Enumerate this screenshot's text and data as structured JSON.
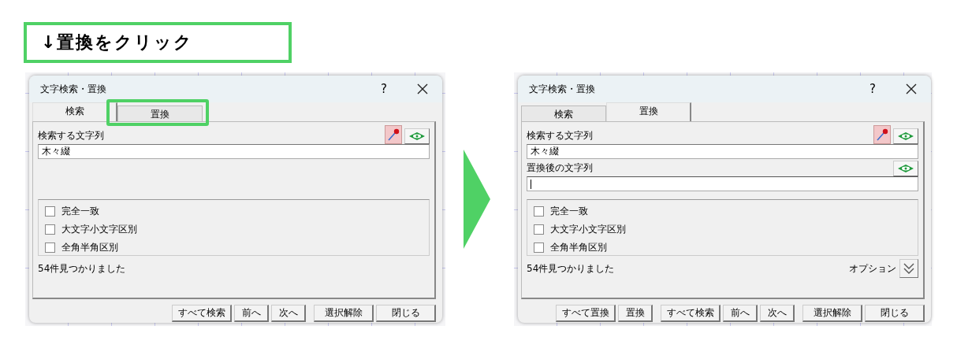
{
  "caption": "↓置換をクリック",
  "dialogs": [
    {
      "title": "文字検索・置換",
      "help": "?",
      "tabs": [
        {
          "label": "検索",
          "selected": true,
          "highlighted": false
        },
        {
          "label": "置換",
          "selected": false,
          "highlighted": true
        }
      ],
      "fields": [
        {
          "kind": "search",
          "label": "検索する文字列",
          "value": "木々綴",
          "focused": false
        }
      ],
      "checkboxes": [
        {
          "label": "完全一致",
          "checked": false
        },
        {
          "label": "大文字小文字区別",
          "checked": false
        },
        {
          "label": "全角半角区別",
          "checked": false
        }
      ],
      "status": "54件見つかりました",
      "button_groups": [
        [
          "すべて検索",
          "前へ",
          "次へ"
        ],
        [
          "選択解除",
          "閉じる"
        ]
      ]
    },
    {
      "title": "文字検索・置換",
      "help": "?",
      "tabs": [
        {
          "label": "検索",
          "selected": false,
          "highlighted": false
        },
        {
          "label": "置換",
          "selected": true,
          "highlighted": false
        }
      ],
      "fields": [
        {
          "kind": "search",
          "label": "検索する文字列",
          "value": "木々綴",
          "focused": false
        },
        {
          "kind": "replace",
          "label": "置換後の文字列",
          "focused": true
        }
      ],
      "checkboxes": [
        {
          "label": "完全一致",
          "checked": false
        },
        {
          "label": "大文字小文字区別",
          "checked": false
        },
        {
          "label": "全角半角区別",
          "checked": false
        }
      ],
      "status": "54件見つかりました",
      "options_toggle": {
        "label": "オプション"
      },
      "button_groups": [
        [
          "すべて置換",
          "置換"
        ],
        [
          "すべて検索",
          "前へ",
          "次へ"
        ],
        [
          "選択解除",
          "閉じる"
        ]
      ]
    }
  ]
}
